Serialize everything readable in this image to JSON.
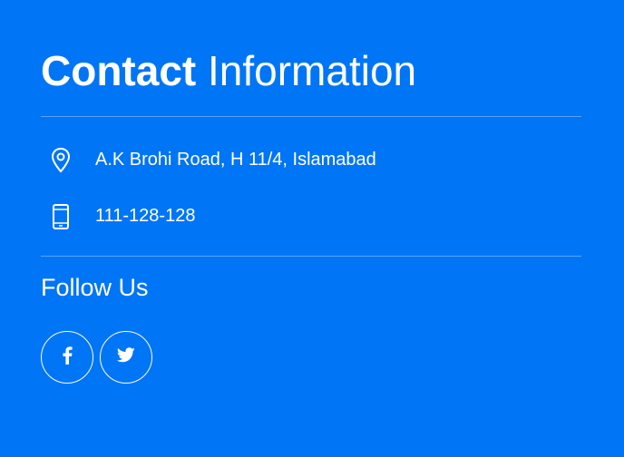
{
  "header": {
    "title_bold": "Contact",
    "title_rest": "Information"
  },
  "contact": {
    "address": "A.K Brohi Road, H 11/4, Islamabad",
    "phone": "111-128-128",
    "address_icon": "location-pin-icon",
    "phone_icon": "mobile-phone-icon"
  },
  "follow": {
    "label": "Follow Us",
    "networks": [
      "facebook-icon",
      "twitter-icon"
    ]
  },
  "colors": {
    "background": "#0075f6",
    "text": "#ffffff"
  }
}
